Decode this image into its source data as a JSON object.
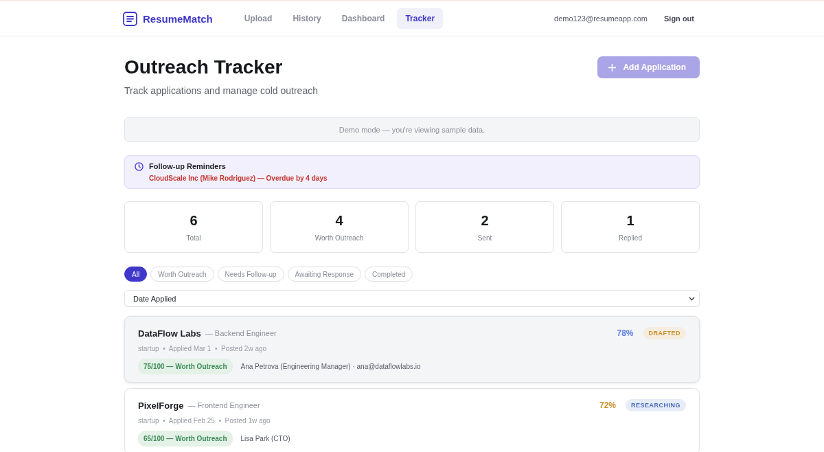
{
  "nav": {
    "brand": "ResumeMatch",
    "links": [
      {
        "label": "Upload",
        "selected": false
      },
      {
        "label": "History",
        "selected": false
      },
      {
        "label": "Dashboard",
        "selected": false
      },
      {
        "label": "Tracker",
        "selected": true
      }
    ],
    "email": "demo123@resumeapp.com",
    "signout": "Sign out"
  },
  "header": {
    "title": "Outreach Tracker",
    "subtitle": "Track applications and manage cold outreach",
    "add_button": "Add Application",
    "add_disabled": true
  },
  "demo_notice": "Demo mode — you're viewing sample data.",
  "reminders": {
    "title": "Follow-up Reminders",
    "items": [
      "CloudScale Inc (Mike Rodriguez) — Overdue by 4 days"
    ]
  },
  "stats": [
    {
      "value": "6",
      "label": "Total"
    },
    {
      "value": "4",
      "label": "Worth Outreach"
    },
    {
      "value": "2",
      "label": "Sent"
    },
    {
      "value": "1",
      "label": "Replied"
    }
  ],
  "filters": [
    {
      "label": "All",
      "selected": true
    },
    {
      "label": "Worth Outreach",
      "selected": false
    },
    {
      "label": "Needs Follow-up",
      "selected": false
    },
    {
      "label": "Awaiting Response",
      "selected": false
    },
    {
      "label": "Completed",
      "selected": false
    }
  ],
  "sort": {
    "value": "Date Applied"
  },
  "applications": [
    {
      "company": "DataFlow Labs",
      "role": "— Backend Engineer",
      "meta": "startup  •  Applied Mar 1  •  Posted 2w ago",
      "match": {
        "text": "78%",
        "color": "#5b7fe0"
      },
      "status": {
        "label": "DRAFTED",
        "kind": "drafted"
      },
      "score": "75/100 — Worth Outreach",
      "contact": "Ana Petrova (Engineering Manager) · ana@dataflowlabs.io",
      "selected": true
    },
    {
      "company": "PixelForge",
      "role": "— Frontend Engineer",
      "meta": "startup  •  Applied Feb 25  •  Posted 1w ago",
      "match": {
        "text": "72%",
        "color": "#c8902a"
      },
      "status": {
        "label": "RESEARCHING",
        "kind": "researching"
      },
      "score": "65/100 — Worth Outreach",
      "contact": "Lisa Park (CTO)",
      "selected": false
    }
  ]
}
